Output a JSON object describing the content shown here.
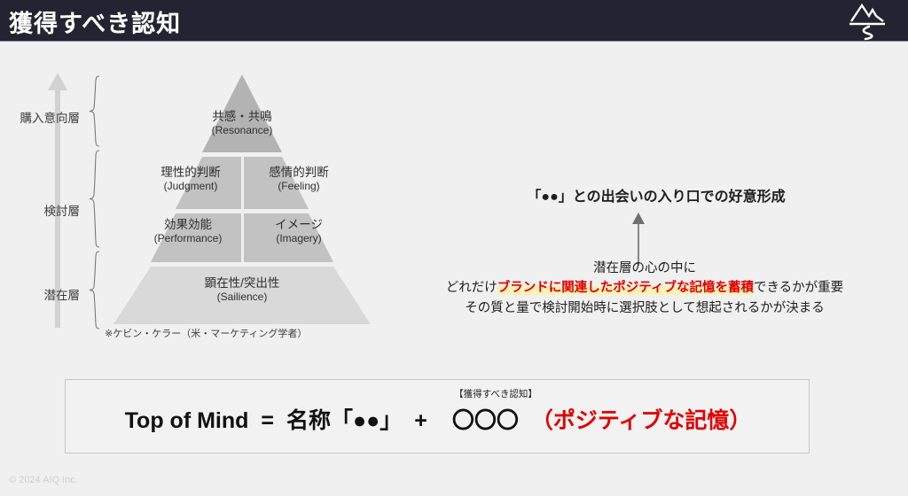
{
  "header": {
    "title": "獲得すべき認知",
    "logo_name": "mountain-river-logo",
    "bg_color": "#232331"
  },
  "axis": {
    "arrow_name": "upward-axis-arrow",
    "layers": [
      {
        "label": "購入意向層"
      },
      {
        "label": "検討層"
      },
      {
        "label": "潜在層"
      }
    ]
  },
  "pyramid": {
    "tiers": [
      {
        "jp": "共感・共鳴",
        "en": "(Resonance)"
      },
      {
        "jp": "理性的判断",
        "en": "(Judgment)"
      },
      {
        "jp": "感情的判断",
        "en": "(Feeling)"
      },
      {
        "jp": "効果効能",
        "en": "(Performance)"
      },
      {
        "jp": "イメージ",
        "en": "(Imagery)"
      },
      {
        "jp": "顕在性/突出性",
        "en": "(Sailience)"
      }
    ],
    "citation": "※ケビン・ケラー（米・マーケティング学者）",
    "color_top": "#b3b3b3",
    "color_mid": "#c2c2c2",
    "color_base": "#d9d9d9"
  },
  "right": {
    "headline": "「●●」との出会いの入り口での好意形成",
    "arrow_name": "upward-pointer-arrow",
    "body_line1": "潜在層の心の中に",
    "body_line2_pre": "どれだけ",
    "body_line2_highlight": "ブランドに関連したポジティブな記憶を蓄積",
    "body_line2_post": "できるかが重要",
    "body_line3": "その質と量で検討開始時に選択肢として想起されるかが決まる",
    "highlight_color": "#e00000",
    "highlight_bg": "#fff1b8"
  },
  "formula": {
    "note": "【獲得すべき認知】",
    "term1": "Top of Mind",
    "equals": "=",
    "term2": "名称「●●」",
    "plus": "+",
    "term3": "〇〇〇",
    "term4_red": "（ポジティブな記憶）"
  },
  "footer": {
    "copyright": "© 2024 AIQ Inc."
  }
}
